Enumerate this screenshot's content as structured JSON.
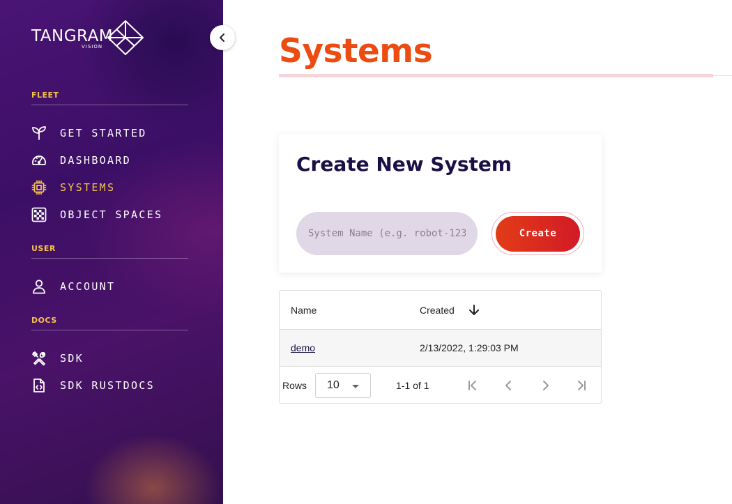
{
  "brand": {
    "name": "TANGRAM",
    "sub": "VISION",
    "logo_icon": "tangram-diamond-icon"
  },
  "sidebar": {
    "sections": {
      "fleet": "FLEET",
      "user": "USER",
      "docs": "DOCS"
    },
    "items": {
      "get_started": {
        "label": "GET STARTED",
        "icon": "sprout-icon"
      },
      "dashboard": {
        "label": "DASHBOARD",
        "icon": "gauge-icon"
      },
      "systems": {
        "label": "SYSTEMS",
        "icon": "chip-icon",
        "active": true
      },
      "object_spaces": {
        "label": "OBJECT SPACES",
        "icon": "checkerboard-icon"
      },
      "account": {
        "label": "ACCOUNT",
        "icon": "user-icon"
      },
      "sdk": {
        "label": "SDK",
        "icon": "tools-icon"
      },
      "sdk_rustdocs": {
        "label": "SDK RUSTDOCS",
        "icon": "code-file-icon"
      }
    },
    "collapse_icon": "chevron-left-icon"
  },
  "page": {
    "title": "Systems"
  },
  "create_card": {
    "title": "Create New System",
    "input_placeholder": "System Name (e.g. robot-123)",
    "input_value": "",
    "button_label": "Create"
  },
  "table": {
    "columns": {
      "name": "Name",
      "created": "Created"
    },
    "sort": {
      "column": "Created",
      "direction": "descending"
    },
    "rows": [
      {
        "name": "demo",
        "created": "2/13/2022, 1:29:03 PM"
      }
    ],
    "footer": {
      "rows_label": "Rows",
      "rows_per_page": "10",
      "page_info": "1-1 of 1"
    }
  },
  "colors": {
    "accent_orange": "#ec4c12",
    "active_yellow": "#f6c24a",
    "sidebar_purple": "#3c0f66",
    "heading_navy": "#1c0f45",
    "create_red": "#d21a26"
  }
}
